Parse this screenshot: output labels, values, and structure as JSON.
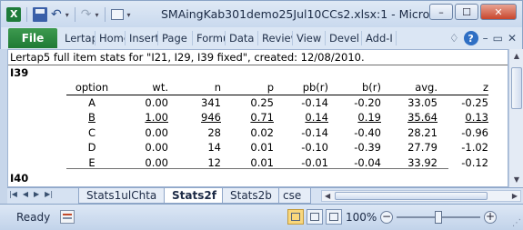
{
  "window": {
    "title": "SMAingKab301demo25Jul10CCs2.xlsx:1  -  Micros...",
    "min_glyph": "–",
    "max_glyph": "☐",
    "close_glyph": "✕"
  },
  "quick_access": {
    "undo_glyph": "↶",
    "redo_glyph": "↷",
    "dropdown_glyph": "▾"
  },
  "ribbon": {
    "file_label": "File",
    "tabs": [
      "Lertap",
      "Home",
      "Insert",
      "Page",
      "Formulas",
      "Data",
      "Review",
      "View",
      "Devel",
      "Add-I"
    ],
    "help_glyph": "?",
    "minimize_glyph": "♢",
    "restore_glyph": "▭",
    "close_glyph": "✕"
  },
  "sheet": {
    "header_text": "Lertap5 full item stats for \"I21, I29, I39 fixed\", created: 12/08/2010.",
    "item_label": "I39",
    "next_item_label": "I40",
    "columns": [
      "option",
      "wt.",
      "n",
      "p",
      "pb(r)",
      "b(r)",
      "avg.",
      "z"
    ],
    "rows": [
      [
        "A",
        "0.00",
        "341",
        "0.25",
        "-0.14",
        "-0.20",
        "33.05",
        "-0.25"
      ],
      [
        "B",
        "1.00",
        "946",
        "0.71",
        "0.14",
        "0.19",
        "35.64",
        "0.13"
      ],
      [
        "C",
        "0.00",
        "28",
        "0.02",
        "-0.14",
        "-0.40",
        "28.21",
        "-0.96"
      ],
      [
        "D",
        "0.00",
        "14",
        "0.01",
        "-0.10",
        "-0.39",
        "27.79",
        "-1.02"
      ],
      [
        "E",
        "0.00",
        "12",
        "0.01",
        "-0.01",
        "-0.04",
        "33.92",
        "-0.12"
      ]
    ],
    "correct_row_index": 1
  },
  "sheet_tabs": {
    "nav_glyphs": [
      "|◀",
      "◀",
      "▶",
      "▶|"
    ],
    "tabs": [
      "Stats1ulChta",
      "Stats2f",
      "Stats2b",
      "cse"
    ],
    "active_index": 1
  },
  "status": {
    "ready_text": "Ready",
    "zoom_text": "100%",
    "zoom_level_percent": 100,
    "zoom_minus": "−",
    "zoom_plus": "+"
  }
}
